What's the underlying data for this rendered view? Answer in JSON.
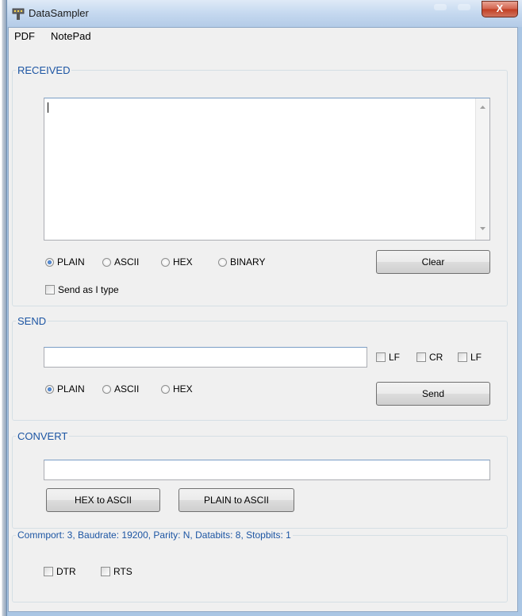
{
  "window": {
    "title": "DataSampler",
    "close_label": "X"
  },
  "menu": {
    "items": [
      "PDF",
      "NotePad"
    ]
  },
  "received": {
    "legend": "RECEIVED",
    "text_value": "",
    "formats": [
      "PLAIN",
      "ASCII",
      "HEX",
      "BINARY"
    ],
    "selected_format": "PLAIN",
    "clear_label": "Clear",
    "send_as_type_label": "Send as I type"
  },
  "send": {
    "legend": "SEND",
    "input_value": "",
    "line_options": [
      "LF",
      "CR",
      "LF"
    ],
    "formats": [
      "PLAIN",
      "ASCII",
      "HEX"
    ],
    "selected_format": "PLAIN",
    "send_label": "Send"
  },
  "convert": {
    "legend": "CONVERT",
    "input_value": "",
    "hex_to_ascii_label": "HEX to ASCII",
    "plain_to_ascii_label": "PLAIN to ASCII"
  },
  "port": {
    "legend": "Commport:  3, Baudrate: 19200, Parity: N, Databits: 8, Stopbits: 1",
    "dtr_label": "DTR",
    "rts_label": "RTS"
  },
  "colors": {
    "legend_text": "#1c55a3",
    "title_gradient": "#c7daf0",
    "close_button": "#c13e22"
  }
}
